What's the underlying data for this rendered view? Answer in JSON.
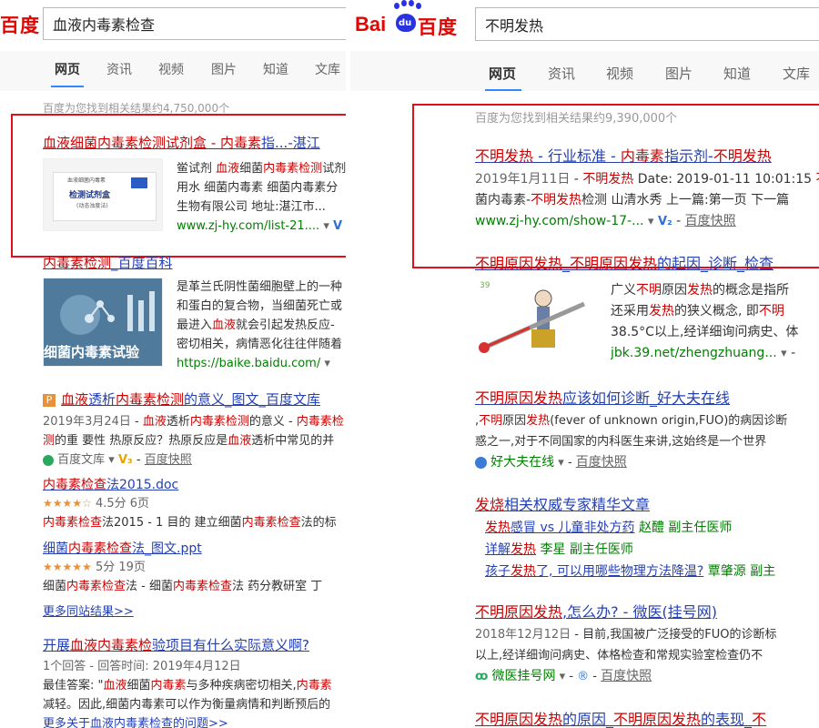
{
  "left": {
    "logo": "百度",
    "query": "血液内毒素检查",
    "tabs": [
      "网页",
      "资讯",
      "视频",
      "图片",
      "知道",
      "文库"
    ],
    "result_count": "百度为您找到相关结果约4,750,000个",
    "r1": {
      "title": [
        "血液",
        "细菌",
        "内毒素检测",
        "试剂盒 - ",
        "内毒素",
        "指...-湛江"
      ],
      "thumb_text": [
        "血液细菌内毒素",
        "检测试剂盒",
        "(动态浊度法)"
      ],
      "line1": [
        "鲎试剂 ",
        "血液",
        "细菌",
        "内毒素检测",
        "试剂"
      ],
      "line2": "用水 细菌内毒素 细菌内毒素分",
      "line3": "生物有限公司 地址:湛江市...",
      "url": "www.zj-hy.com/list-21....",
      "vbadge": "V"
    },
    "r2": {
      "title": [
        "内毒素检测",
        "_百度百科"
      ],
      "thumb_caption": "细菌内毒素试验",
      "lines": [
        "是革兰氏阴性菌细胞壁上的一种",
        "和蛋白的复合物，当细菌死亡或",
        "最进入",
        "血液",
        "就会引起发热反应-",
        "密切相关，病情恶化往往伴随着"
      ],
      "url": "https://baike.baidu.com/"
    },
    "r3": {
      "doc_icon": "P",
      "title": [
        "血液",
        "透析",
        "内毒素检测",
        "的意义_图文_百度文库"
      ],
      "date": "2019年3月24日",
      "line1_rest": [
        "血液",
        "透析",
        "内毒素检测",
        "的意义 - ",
        "内毒素检"
      ],
      "line2": [
        "测",
        "的重 要性 热原反应？热原反应是",
        "血液",
        "透析中常见的并"
      ],
      "source": "百度文库",
      "vbadge": "V₃",
      "kuaizhao": "百度快照"
    },
    "r3a": {
      "title": [
        "内毒素检查",
        "法2015.doc"
      ],
      "rating": "4.5分",
      "pages": "6页",
      "snippet": [
        "内毒素检查",
        "法2015 - 1 目的 建立细菌",
        "内毒素检查",
        "法的标"
      ]
    },
    "r3b": {
      "title": [
        "细菌",
        "内毒素检查",
        "法_图文.ppt"
      ],
      "rating": "5分",
      "pages": "19页",
      "snippet": [
        "细菌",
        "内毒素检查",
        "法 - 细菌",
        "内毒素检查",
        "法 药分教研室 丁"
      ]
    },
    "more_site": "更多同站结果>>",
    "r4": {
      "title": [
        "开展",
        "血液内毒素检",
        "验项目有什么实际意义啊?"
      ],
      "meta": "1个回答 - 回答时间: 2019年4月12日",
      "line1": [
        "最佳答案: \"",
        "血液",
        "细菌",
        "内毒素",
        "与多种疾病密切相关,",
        "内毒素"
      ],
      "line2": "减轻。因此,细菌内毒素可以作为衡量病情和判断预后的",
      "more": "更多关于血液内毒素检查的问题>>"
    }
  },
  "right": {
    "logo_bai": "Bai",
    "logo_du": "du",
    "logo_baidu_cn": "百度",
    "query": "不明发热",
    "tabs": [
      "网页",
      "资讯",
      "视频",
      "图片",
      "知道",
      "文库"
    ],
    "result_count": "百度为您找到相关结果约9,390,000个",
    "r1": {
      "title": [
        "不明发热",
        " - 行业标准 - ",
        "内毒素",
        "指示剂-",
        "不明发热"
      ],
      "line1": [
        "2019年1月11日",
        " - ",
        "不明发热",
        " Date: 2019-01-11 10:01:15 ",
        "不"
      ],
      "line2": [
        "菌内毒素-",
        "不明发热",
        "检测 山清水秀 上一篇:第一页 下一篇"
      ],
      "url": "www.zj-hy.com/show-17-...",
      "vbadge": "V₂",
      "kuaizhao": "百度快照"
    },
    "r2": {
      "title": [
        "不明原因发热",
        "_",
        "不明原因发热",
        "的起因_诊断_检查"
      ],
      "lines": [
        [
          "广义",
          "不明",
          "原因",
          "发热",
          "的概念是指所"
        ],
        [
          "还采用",
          "发热",
          "的狭义概念, 即",
          "不明"
        ],
        [
          "38.5°C以上,经详细询问病史、体"
        ]
      ],
      "url": "jbk.39.net/zhengzhuang..."
    },
    "r3": {
      "title": [
        "不明原因发热",
        "应该如何诊断_好大夫在线"
      ],
      "line1": [
        ",",
        "不明",
        "原因",
        "发热",
        "(fever of unknown origin,FUO)的病因诊断"
      ],
      "line2": "惑之一,对于不同国家的内科医生来讲,这始终是一个世界",
      "source": "好大夫在线",
      "kuaizhao": "百度快照"
    },
    "r4": {
      "title": [
        "发烧",
        "相关权威专家精华文章"
      ],
      "items": [
        {
          "parts": [
            "发热",
            "感冒 vs 儿童非处方药"
          ],
          "doctor": "赵醴",
          "rank": "副主任医师"
        },
        {
          "parts": [
            "详解",
            "发热"
          ],
          "doctor": "李星",
          "rank": "副主任医师"
        },
        {
          "parts": [
            "孩子",
            "发热",
            "了, 可以用哪些物理方法降温?"
          ],
          "doctor": "覃肇源",
          "rank": "副主"
        }
      ]
    },
    "r5": {
      "title": [
        "不明原因发热",
        ",怎么办? - 微医(挂号网)"
      ],
      "line1": [
        "2018年12月12日",
        " - 目前,我国被广泛接受的FUO的诊断标"
      ],
      "line2": "以上,经详细询问病史、体格检查和常规实验室检查仍不",
      "source": "微医挂号网",
      "kuaizhao": "百度快照"
    },
    "r6": {
      "title": [
        "不明原因发热",
        "的原因_",
        "不明原因发热",
        "的表现_",
        "不"
      ]
    }
  }
}
